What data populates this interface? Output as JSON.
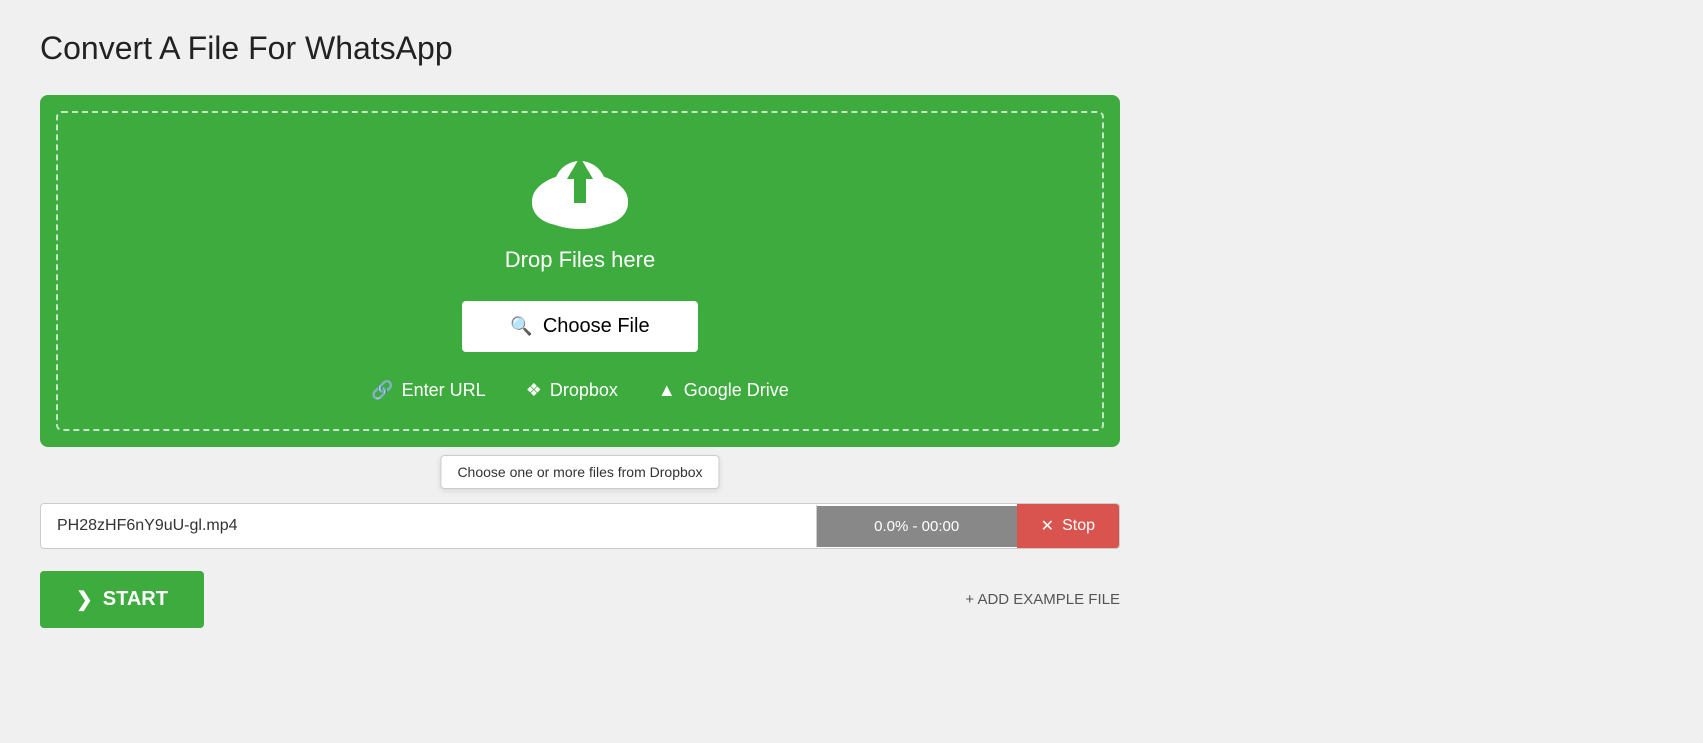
{
  "page": {
    "title": "Convert A File For WhatsApp"
  },
  "upload": {
    "drop_text": "Drop Files here",
    "choose_file_label": "Choose File",
    "enter_url_label": "Enter URL",
    "dropbox_label": "Dropbox",
    "google_drive_label": "Google Drive",
    "tooltip_text": "Choose one or more files from Dropbox"
  },
  "file_row": {
    "file_name": "PH28zHF6nY9uU-gl.mp4",
    "progress": "0.0% - 00:00",
    "stop_label": "Stop"
  },
  "actions": {
    "start_label": "START",
    "add_example_label": "+ ADD EXAMPLE FILE"
  },
  "icons": {
    "search": "🔍",
    "link": "🔗",
    "chevron_right": "❯",
    "close": "✕",
    "plus": "+"
  }
}
